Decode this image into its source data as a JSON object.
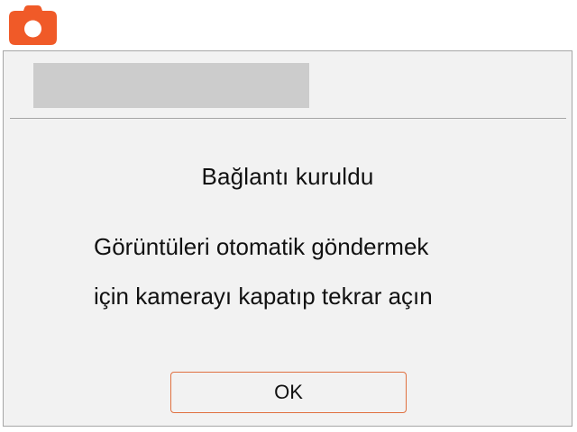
{
  "app": {
    "icon": "camera-icon",
    "accent_color": "#f05a28"
  },
  "dialog": {
    "title": "Bağlantı kuruldu",
    "message_lines": [
      "Görüntüleri otomatik göndermek",
      "için kamerayı kapatıp tekrar açın"
    ],
    "ok_label": "OK",
    "ok_border_color": "#e07040"
  }
}
